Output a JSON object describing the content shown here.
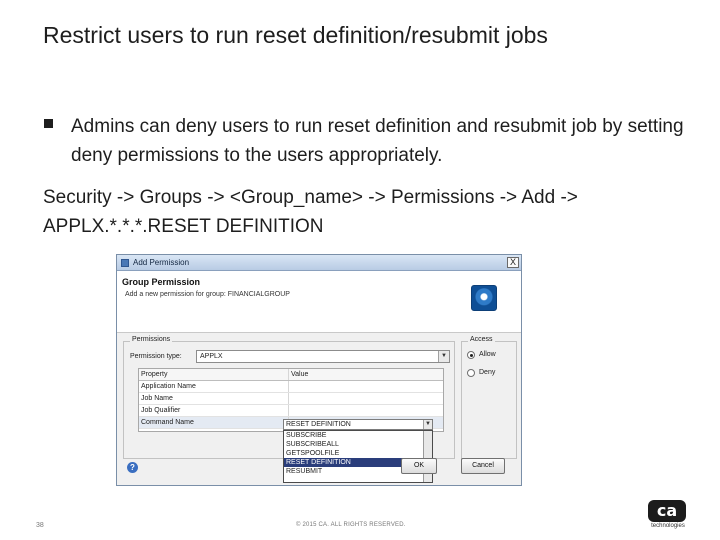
{
  "slide": {
    "title": "Restrict users to run reset definition/resubmit jobs",
    "bullet": "Admins can deny users to run reset definition and resubmit job by setting deny permissions to the users appropriately.",
    "path": "Security -> Groups -> <Group_name> -> Permissions -> Add -> APPLX.*.*.*.RESET DEFINITION"
  },
  "dialog": {
    "title": "Add Permission",
    "close_label": "X",
    "header_title": "Group Permission",
    "header_desc": "Add a new permission for group: FINANCIALGROUP",
    "header_icon": "gear-icon",
    "permissions_legend": "Permissions",
    "permission_type_label": "Permission type:",
    "permission_type_value": "APPLX",
    "table_headers": {
      "property": "Property",
      "value": "Value"
    },
    "rows": [
      {
        "property": "Application Name",
        "value": ""
      },
      {
        "property": "Job Name",
        "value": ""
      },
      {
        "property": "Job Qualifier",
        "value": ""
      },
      {
        "property": "Command Name",
        "value": "RESET DEFINITION"
      }
    ],
    "value_selected": "RESET DEFINITION",
    "value_options": [
      "SUBSCRIBE",
      "SUBSCRIBEALL",
      "GETSPOOLFILE",
      "RESET DEFINITION",
      "RESUBMIT"
    ],
    "highlight_index": 3,
    "access_legend": "Access",
    "access_options": [
      {
        "label": "Allow",
        "checked": true
      },
      {
        "label": "Deny",
        "checked": false
      }
    ],
    "help_label": "?",
    "cancel_label": "Cancel",
    "ok_label": "OK"
  },
  "footer": {
    "page_number": "38",
    "copyright": "© 2015 CA. ALL RIGHTS RESERVED.",
    "logo_mark": "ca",
    "logo_text": "technologies"
  }
}
